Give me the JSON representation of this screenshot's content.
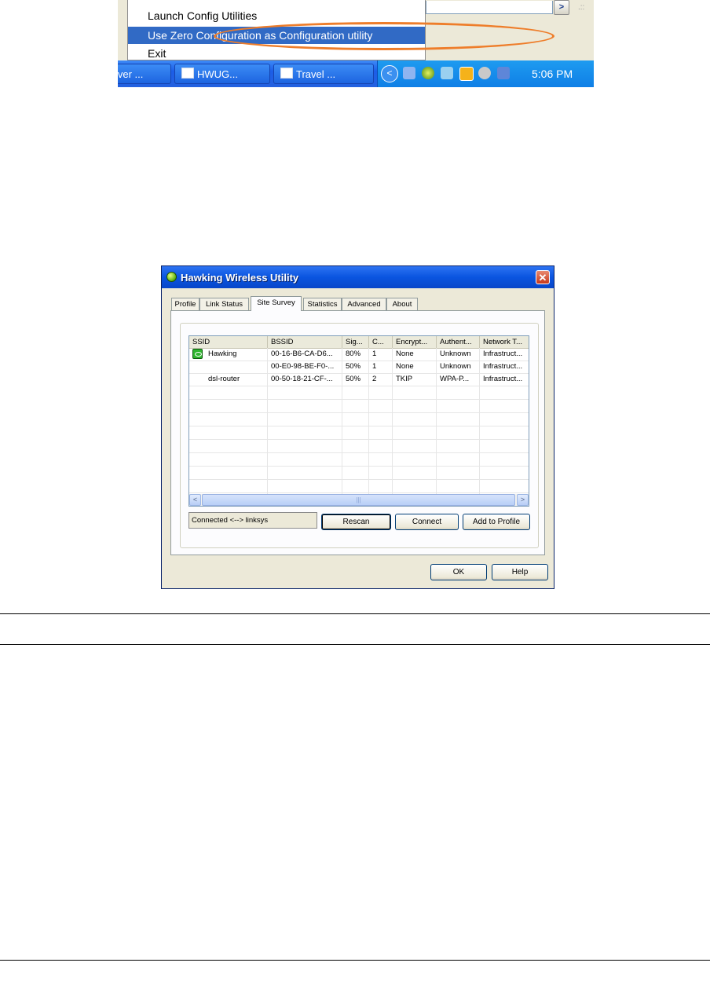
{
  "tray_screenshot": {
    "context_menu": {
      "items": [
        "Launch Config Utilities",
        "Use Zero Configuration as Configuration utility",
        "Exit"
      ],
      "selected_index": 1
    },
    "taskbar": {
      "buttons": [
        "iver ...",
        "HWUG...",
        "Travel ..."
      ],
      "clock": "5:06 PM"
    },
    "highlight_color": "#ee7d2a"
  },
  "dialog": {
    "title": "Hawking Wireless Utility",
    "close_glyph": "✕",
    "tabs": [
      "Profile",
      "Link Status",
      "Site Survey",
      "Statistics",
      "Advanced",
      "About"
    ],
    "active_tab": "Site Survey",
    "site_survey": {
      "columns": [
        "SSID",
        "BSSID",
        "Sig...",
        "C...",
        "Encrypt...",
        "Authent...",
        "Network T..."
      ],
      "rows": [
        {
          "connected": true,
          "ssid": "Hawking",
          "bssid": "00-16-B6-CA-D6...",
          "signal": "80%",
          "channel": "1",
          "encryption": "None",
          "authentication": "Unknown",
          "network_type": "Infrastruct..."
        },
        {
          "connected": false,
          "ssid": "",
          "bssid": "00-E0-98-BE-F0-...",
          "signal": "50%",
          "channel": "1",
          "encryption": "None",
          "authentication": "Unknown",
          "network_type": "Infrastruct..."
        },
        {
          "connected": false,
          "ssid": "dsl-router",
          "bssid": "00-50-18-21-CF-...",
          "signal": "50%",
          "channel": "2",
          "encryption": "TKIP",
          "authentication": "WPA-P...",
          "network_type": "Infrastruct..."
        }
      ],
      "status": "Connected <--> linksys",
      "buttons": {
        "rescan": "Rescan",
        "connect": "Connect",
        "add_to_profile": "Add to Profile"
      }
    },
    "footer_buttons": {
      "ok": "OK",
      "help": "Help"
    }
  }
}
